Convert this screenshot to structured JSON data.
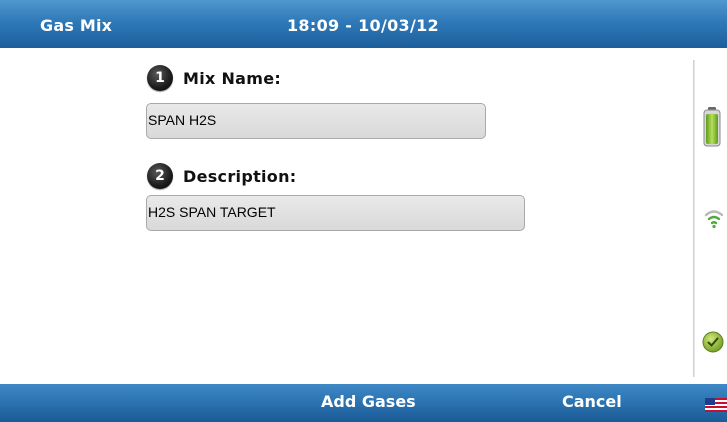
{
  "header": {
    "title": "Gas Mix",
    "datetime": "18:09 - 10/03/12"
  },
  "form": {
    "steps": [
      {
        "number": "1",
        "label": "Mix Name:",
        "value": "SPAN H2S"
      },
      {
        "number": "2",
        "label": "Description:",
        "value": "H2S SPAN TARGET"
      }
    ]
  },
  "status_icons": [
    "battery-icon",
    "wifi-signal-icon",
    "status-ok-check-icon"
  ],
  "footer": {
    "add_gases_label": "Add Gases",
    "cancel_label": "Cancel",
    "language_icon": "us-flag-icon"
  },
  "colors": {
    "header_blue": "#2f79b8",
    "footer_blue": "#2a72b0",
    "field_gray": "#dedede",
    "battery_green": "#8cc63f",
    "check_green": "#7aa62e"
  }
}
